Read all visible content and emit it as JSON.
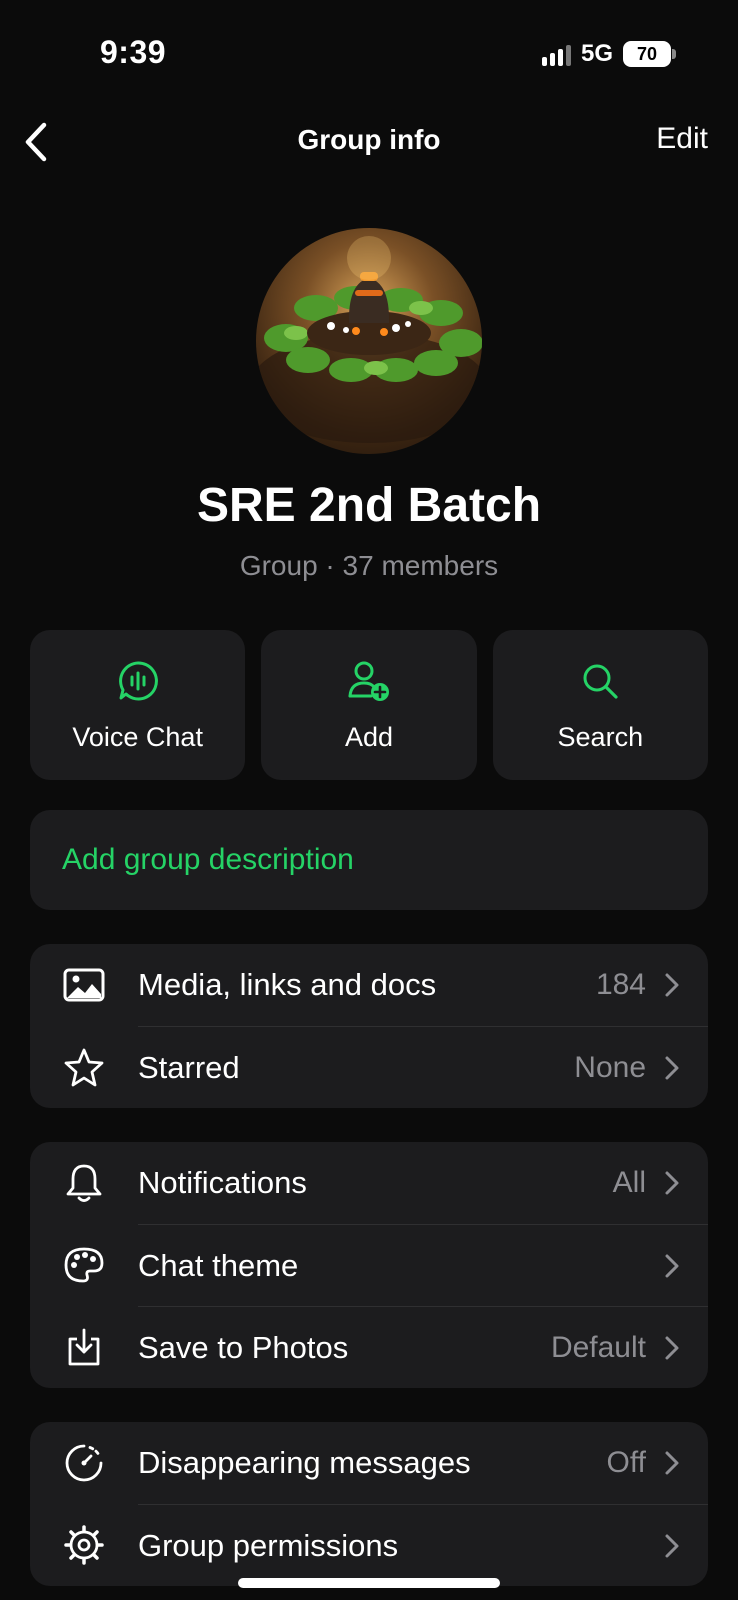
{
  "status_bar": {
    "time": "9:39",
    "network": "5G",
    "battery": "70"
  },
  "header": {
    "title": "Group info",
    "edit_label": "Edit"
  },
  "group": {
    "name": "SRE 2nd Batch",
    "subtitle": "Group · 37 members"
  },
  "actions": [
    {
      "label": "Voice Chat",
      "icon": "voice-chat-icon"
    },
    {
      "label": "Add",
      "icon": "add-person-icon"
    },
    {
      "label": "Search",
      "icon": "search-icon"
    }
  ],
  "description": {
    "label": "Add group description"
  },
  "section1": [
    {
      "label": "Media, links and docs",
      "value": "184",
      "icon": "image-icon"
    },
    {
      "label": "Starred",
      "value": "None",
      "icon": "star-icon"
    }
  ],
  "section2": [
    {
      "label": "Notifications",
      "value": "All",
      "icon": "bell-icon"
    },
    {
      "label": "Chat theme",
      "value": "",
      "icon": "palette-icon"
    },
    {
      "label": "Save to Photos",
      "value": "Default",
      "icon": "download-icon"
    }
  ],
  "section3": [
    {
      "label": "Disappearing messages",
      "value": "Off",
      "icon": "timer-icon"
    },
    {
      "label": "Group permissions",
      "value": "",
      "icon": "settings-gear-icon"
    }
  ],
  "colors": {
    "accent": "#25d366",
    "background": "#0b0b0b",
    "card": "#1c1c1e",
    "muted": "#8e8e93"
  }
}
